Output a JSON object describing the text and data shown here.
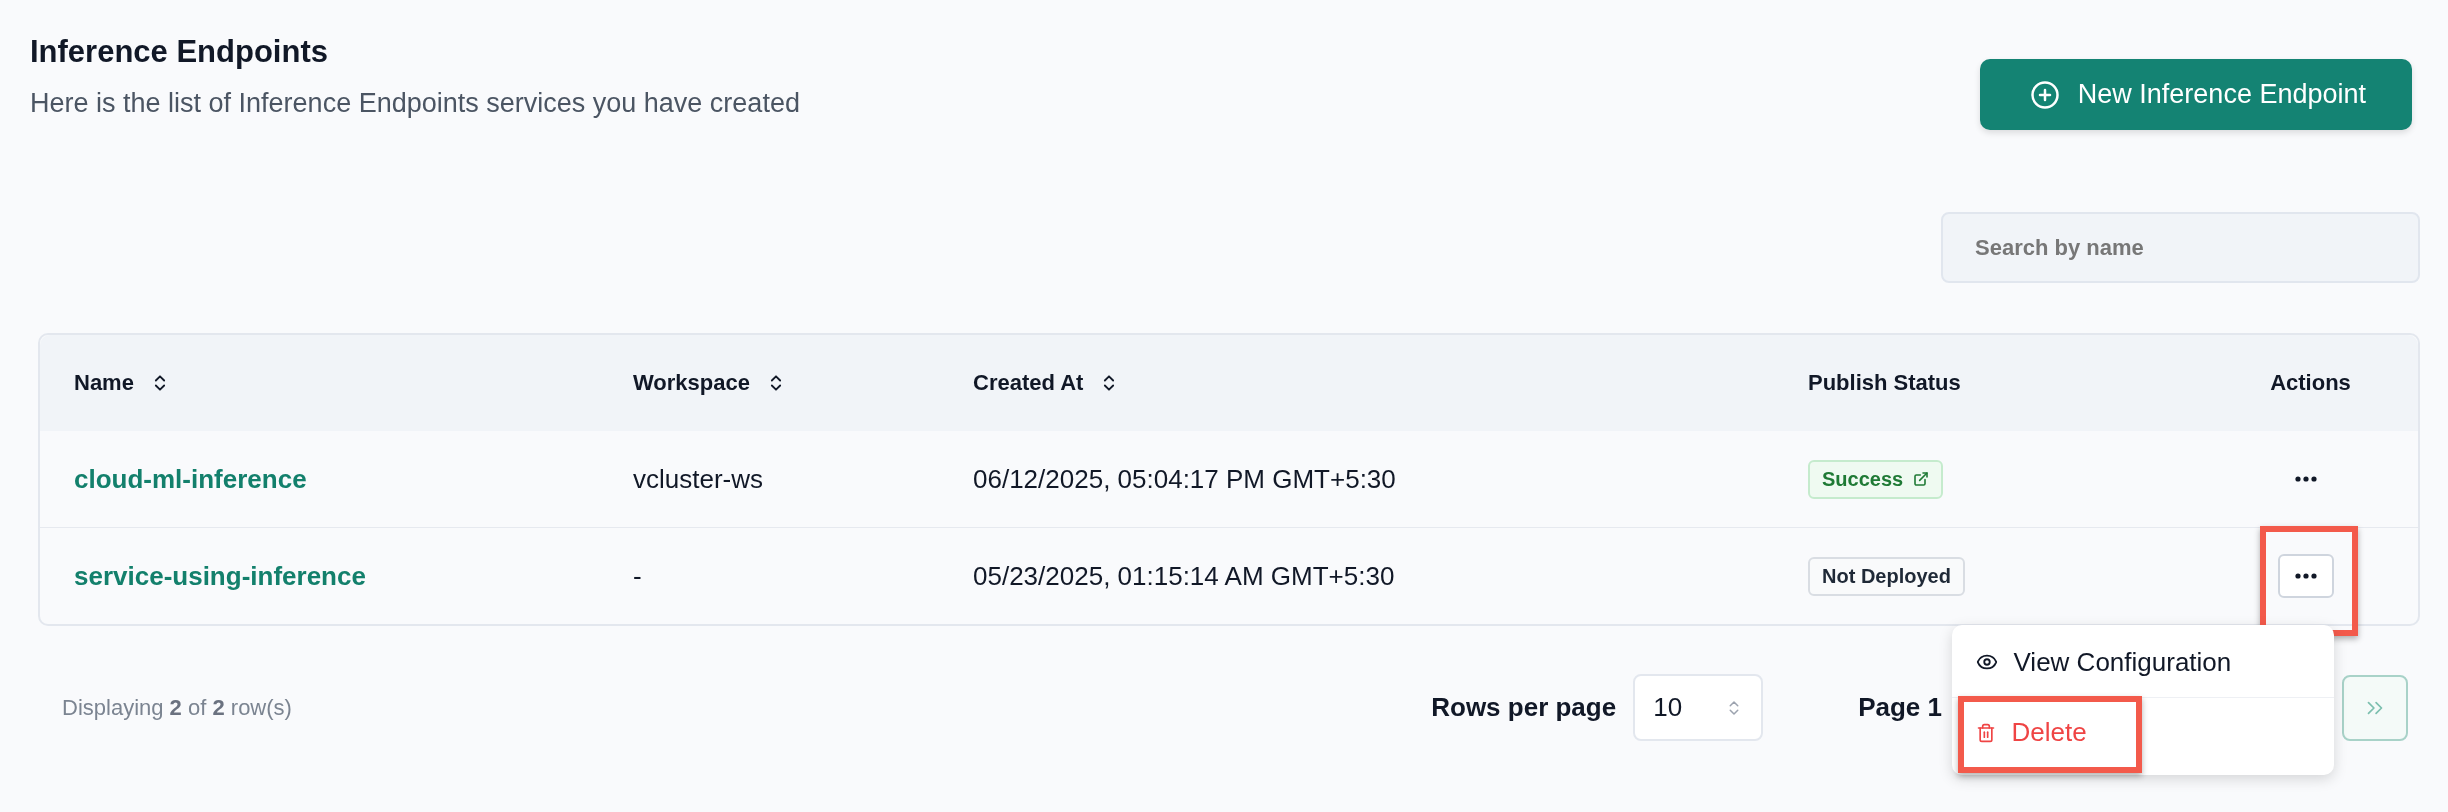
{
  "header": {
    "title": "Inference Endpoints",
    "subtitle": "Here is the list of Inference Endpoints services you have created"
  },
  "new_button": {
    "label": "New Inference Endpoint"
  },
  "search": {
    "placeholder": "Search by name"
  },
  "table": {
    "columns": [
      {
        "label": "Name",
        "sortable": true
      },
      {
        "label": "Workspace",
        "sortable": true
      },
      {
        "label": "Created At",
        "sortable": true
      },
      {
        "label": "Publish Status",
        "sortable": false
      },
      {
        "label": "Actions",
        "sortable": false
      }
    ],
    "rows": [
      {
        "name": "cloud-ml-inference",
        "workspace": "vcluster-ws",
        "created_at": "06/12/2025, 05:04:17 PM GMT+5:30",
        "status": {
          "label": "Success",
          "kind": "success"
        },
        "actions_highlighted": false,
        "menu_open": false
      },
      {
        "name": "service-using-inference",
        "workspace": "-",
        "created_at": "05/23/2025, 01:15:14 AM GMT+5:30",
        "status": {
          "label": "Not Deployed",
          "kind": "neutral"
        },
        "actions_highlighted": true,
        "menu_open": true
      }
    ]
  },
  "menu": {
    "items": [
      {
        "label": "View Configuration",
        "kind": "view",
        "highlighted": false
      },
      {
        "label": "Delete",
        "kind": "delete",
        "highlighted": true
      }
    ]
  },
  "footer": {
    "summary": "Displaying **2** of **2** row(s)",
    "rows_per_page_label": "Rows per page",
    "rows_per_page_value": "10",
    "page_label": "Page 1"
  }
}
